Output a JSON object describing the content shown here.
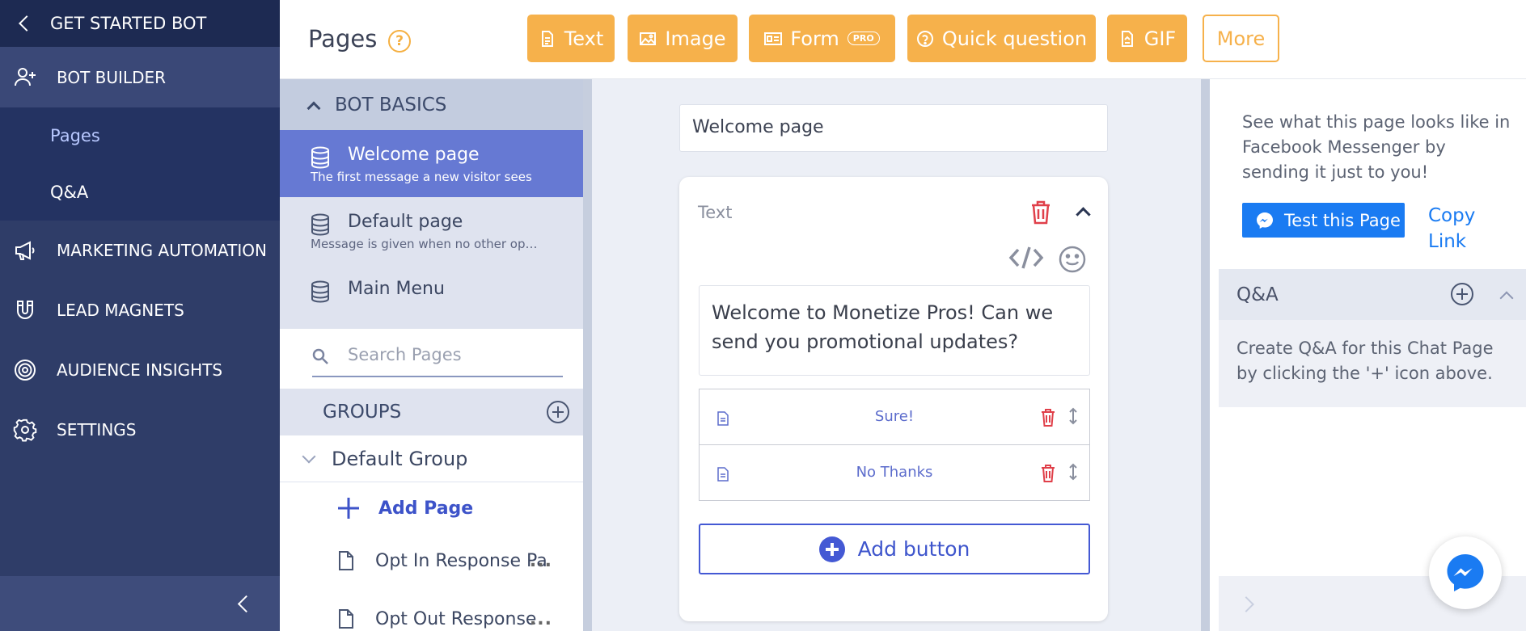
{
  "nav": {
    "back_label": "GET STARTED BOT",
    "bot_builder": "BOT BUILDER",
    "sub_items": [
      "Pages",
      "Q&A"
    ],
    "items": [
      {
        "label": "MARKETING AUTOMATION",
        "icon": "megaphone-icon"
      },
      {
        "label": "LEAD MAGNETS",
        "icon": "magnet-icon"
      },
      {
        "label": "AUDIENCE INSIGHTS",
        "icon": "target-icon"
      },
      {
        "label": "SETTINGS",
        "icon": "gear-icon"
      }
    ]
  },
  "topbar": {
    "title": "Pages",
    "help": "?",
    "buttons": {
      "text": "Text",
      "image": "Image",
      "form": "Form",
      "form_badge": "PRO",
      "quick": "Quick question",
      "gif": "GIF",
      "more": "More"
    }
  },
  "pages_panel": {
    "section": "BOT BASICS",
    "pages": [
      {
        "name": "Welcome page",
        "desc": "The first message a new visitor sees"
      },
      {
        "name": "Default page",
        "desc": "Message is given when no other option is ..."
      },
      {
        "name": "Main Menu",
        "desc": ""
      }
    ],
    "search_placeholder": "Search Pages",
    "groups_label": "GROUPS",
    "default_group": "Default Group",
    "add_page": "Add Page",
    "group_pages": [
      "Opt In Response Pa",
      "Opt Out Response"
    ],
    "ellipsis": "..."
  },
  "editor": {
    "page_name": "Welcome page",
    "block_label": "Text",
    "message": "Welcome to Monetize Pros! Can we send you promotional updates?",
    "quick_replies": [
      "Sure!",
      "No Thanks"
    ],
    "add_button": "Add button"
  },
  "right": {
    "info": "See what this page looks like in Facebook Messenger by sending it just to you!",
    "test_button": "Test this Page",
    "copy_link": "Copy Link",
    "qa_title": "Q&A",
    "qa_desc": "Create Q&A for this Chat Page by clicking the '+' icon above."
  },
  "colors": {
    "nav_bg": "#2f3d68",
    "accent_orange": "#f6b14b",
    "active_page": "#6679d3",
    "primary_blue": "#4459d4",
    "messenger_blue": "#1a7bf2",
    "delete_red": "#e0404a"
  }
}
